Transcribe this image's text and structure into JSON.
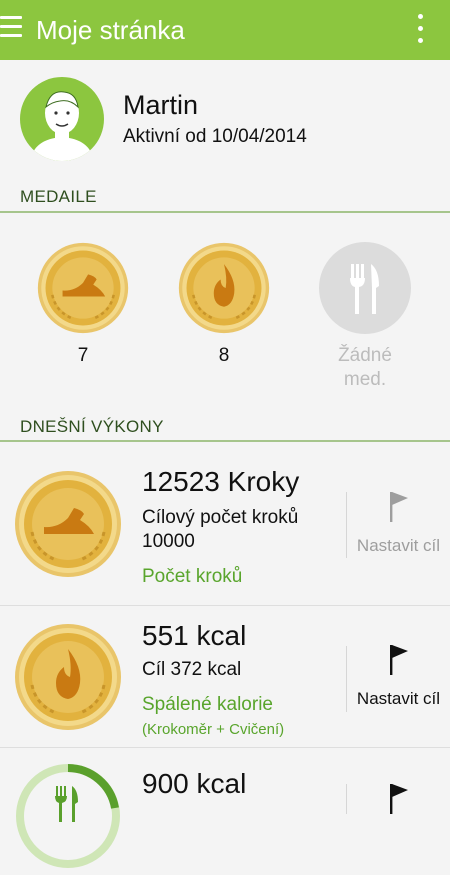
{
  "app": {
    "title": "Moje stránka"
  },
  "profile": {
    "name": "Martin",
    "active_since": "Aktivní od 10/04/2014"
  },
  "medals": {
    "section_title": "MEDAILE",
    "items": [
      {
        "icon": "shoe-icon",
        "count": "7"
      },
      {
        "icon": "flame-icon",
        "count": "8"
      },
      {
        "icon": "fork-knife-icon",
        "none_line1": "Žádné",
        "none_line2": "med."
      }
    ]
  },
  "today": {
    "section_title": "DNEŠNÍ VÝKONY",
    "rows": [
      {
        "title": "12523 Kroky",
        "sub_line1": "Cílový počet kroků",
        "sub_line2": "10000",
        "link": "Počet kroků",
        "goal_label": "Nastavit cíl",
        "goal_flag_color": "#9e9e9e"
      },
      {
        "title": "551 kcal",
        "sub_line1": "Cíl 372 kcal",
        "link": "Spálené kalorie",
        "note": "(Krokoměr + Cvičení)",
        "goal_label": "Nastavit cíl",
        "goal_flag_color": "#111111"
      },
      {
        "title": "900 kcal"
      }
    ]
  },
  "colors": {
    "accent": "#8cc63f",
    "link": "#59a52c",
    "gold": "#e2b23e"
  }
}
